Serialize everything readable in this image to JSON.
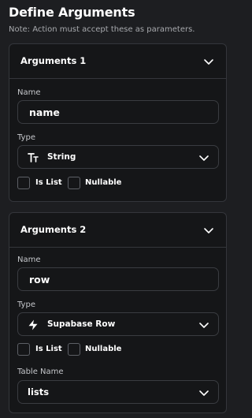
{
  "header": {
    "title": "Define Arguments",
    "note": "Note: Action must accept these as parameters."
  },
  "arguments": [
    {
      "title": "Arguments 1",
      "name_label": "Name",
      "name_value": "name",
      "type_label": "Type",
      "type_value": "String",
      "type_icon": "text-type-icon",
      "is_list_label": "Is List",
      "nullable_label": "Nullable"
    },
    {
      "title": "Arguments 2",
      "name_label": "Name",
      "name_value": "row",
      "type_label": "Type",
      "type_value": "Supabase Row",
      "type_icon": "supabase-icon",
      "is_list_label": "Is List",
      "nullable_label": "Nullable",
      "table_label": "Table Name",
      "table_value": "lists"
    }
  ],
  "colors": {
    "background": "#1d1e21",
    "card": "#151618",
    "border": "#34363b",
    "muted_text": "#a7a9ad"
  }
}
